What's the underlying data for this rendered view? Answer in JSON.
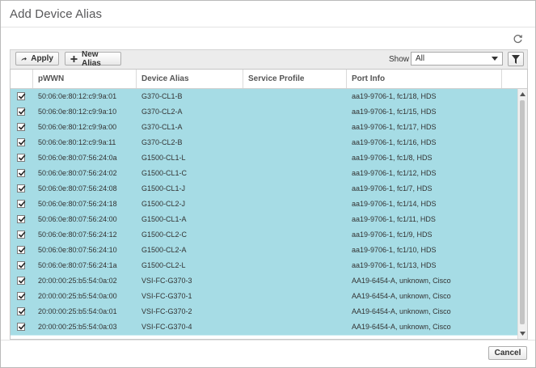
{
  "dialog": {
    "title": "Add Device Alias",
    "refresh_icon": "refresh-icon"
  },
  "toolbar": {
    "apply_label": "Apply",
    "apply_icon": "arrow-right-icon",
    "new_alias_label": "New Alias",
    "new_alias_icon": "plus-icon",
    "show_label": "Show",
    "show_value": "All",
    "filter_icon": "filter-icon"
  },
  "table": {
    "columns": [
      "pWWN",
      "Device Alias",
      "Service Profile",
      "Port Info"
    ],
    "row_color": "#a6dce5",
    "rows": [
      {
        "checked": true,
        "pwwn": "50:06:0e:80:12:c9:9a:01",
        "alias": "G370-CL1-B",
        "service_profile": "",
        "port_info": "aa19-9706-1, fc1/18, HDS"
      },
      {
        "checked": true,
        "pwwn": "50:06:0e:80:12:c9:9a:10",
        "alias": "G370-CL2-A",
        "service_profile": "",
        "port_info": "aa19-9706-1, fc1/15, HDS"
      },
      {
        "checked": true,
        "pwwn": "50:06:0e:80:12:c9:9a:00",
        "alias": "G370-CL1-A",
        "service_profile": "",
        "port_info": "aa19-9706-1, fc1/17, HDS"
      },
      {
        "checked": true,
        "pwwn": "50:06:0e:80:12:c9:9a:11",
        "alias": "G370-CL2-B",
        "service_profile": "",
        "port_info": "aa19-9706-1, fc1/16, HDS"
      },
      {
        "checked": true,
        "pwwn": "50:06:0e:80:07:56:24:0a",
        "alias": "G1500-CL1-L",
        "service_profile": "",
        "port_info": "aa19-9706-1, fc1/8, HDS"
      },
      {
        "checked": true,
        "pwwn": "50:06:0e:80:07:56:24:02",
        "alias": "G1500-CL1-C",
        "service_profile": "",
        "port_info": "aa19-9706-1, fc1/12, HDS"
      },
      {
        "checked": true,
        "pwwn": "50:06:0e:80:07:56:24:08",
        "alias": "G1500-CL1-J",
        "service_profile": "",
        "port_info": "aa19-9706-1, fc1/7, HDS"
      },
      {
        "checked": true,
        "pwwn": "50:06:0e:80:07:56:24:18",
        "alias": "G1500-CL2-J",
        "service_profile": "",
        "port_info": "aa19-9706-1, fc1/14, HDS"
      },
      {
        "checked": true,
        "pwwn": "50:06:0e:80:07:56:24:00",
        "alias": "G1500-CL1-A",
        "service_profile": "",
        "port_info": "aa19-9706-1, fc1/11, HDS"
      },
      {
        "checked": true,
        "pwwn": "50:06:0e:80:07:56:24:12",
        "alias": "G1500-CL2-C",
        "service_profile": "",
        "port_info": "aa19-9706-1, fc1/9, HDS"
      },
      {
        "checked": true,
        "pwwn": "50:06:0e:80:07:56:24:10",
        "alias": "G1500-CL2-A",
        "service_profile": "",
        "port_info": "aa19-9706-1, fc1/10, HDS"
      },
      {
        "checked": true,
        "pwwn": "50:06:0e:80:07:56:24:1a",
        "alias": "G1500-CL2-L",
        "service_profile": "",
        "port_info": "aa19-9706-1, fc1/13, HDS"
      },
      {
        "checked": true,
        "pwwn": "20:00:00:25:b5:54:0a:02",
        "alias": "VSI-FC-G370-3",
        "service_profile": "",
        "port_info": "AA19-6454-A, unknown, Cisco"
      },
      {
        "checked": true,
        "pwwn": "20:00:00:25:b5:54:0a:00",
        "alias": "VSI-FC-G370-1",
        "service_profile": "",
        "port_info": "AA19-6454-A, unknown, Cisco"
      },
      {
        "checked": true,
        "pwwn": "20:00:00:25:b5:54:0a:01",
        "alias": "VSI-FC-G370-2",
        "service_profile": "",
        "port_info": "AA19-6454-A, unknown, Cisco"
      },
      {
        "checked": true,
        "pwwn": "20:00:00:25:b5:54:0a:03",
        "alias": "VSI-FC-G370-4",
        "service_profile": "",
        "port_info": "AA19-6454-A, unknown, Cisco"
      }
    ]
  },
  "footer": {
    "cancel_label": "Cancel"
  }
}
